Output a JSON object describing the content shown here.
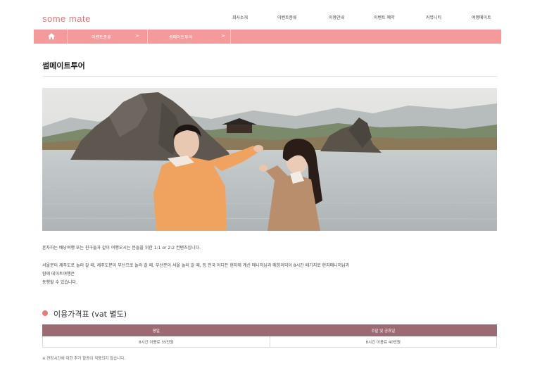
{
  "header": {
    "logo_text": "some mate",
    "nav_items": [
      "회사소개",
      "이벤트종류",
      "이용안내",
      "이벤트 예약",
      "커뮤니티",
      "여행메이트"
    ]
  },
  "breadcrumb": {
    "home_icon": "home-icon",
    "items": [
      "이벤트종류",
      "썸메이트투어"
    ],
    "arrow": ">"
  },
  "page": {
    "title": "썸메이트투어"
  },
  "hero": {
    "image_description": "couple-pointing-at-lake-rocks-photo"
  },
  "description": {
    "line1": "혼자하는 배낭여행 또는 친구들과 같이 여행오시는 분들을 위한 1:1 or 2:2 컨텐츠입니다.",
    "line2": "서울분이 제주도로 놀러 갈 때, 제주도분이 부산으로 놀러 갈 때, 부산분이 서울 놀러 갈 때, 등 전국 어디든 현지에 계신 매니저님과 매칭이되어 8시간 때기지로 현지매니저님과",
    "line3": "함께 데이트여행은",
    "line4": "동행할 수 있습니다."
  },
  "pricing": {
    "section_title": "이용가격표 (vat 별도)",
    "columns": [
      "평일",
      "주말 및 공휴일"
    ],
    "rows": [
      [
        "8시간 이용료 35만원",
        "8시간 이용료 40만원"
      ]
    ],
    "note": "※ 연장시간에 대한 추가 할증이 적용되지 않습니다."
  },
  "colors": {
    "brand_pink": "#f5999b",
    "logo_pink": "#e0787a",
    "table_header": "#9b6a72",
    "section_dot": "#e57c7c"
  }
}
